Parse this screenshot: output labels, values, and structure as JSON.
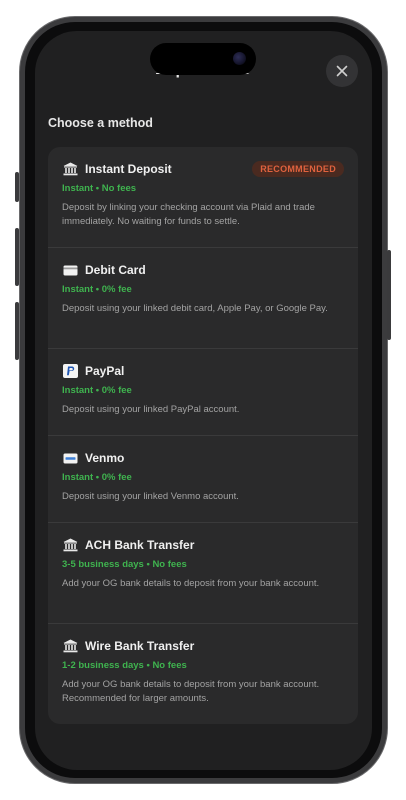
{
  "sheet": {
    "title": "Deposit USD",
    "section_label": "Choose a method",
    "close_glyph": "✕"
  },
  "methods": [
    {
      "icon": "bank-icon",
      "name": "Instant Deposit",
      "badge": "RECOMMENDED",
      "meta": "Instant • No fees",
      "description": "Deposit by linking your checking account via Plaid and trade immediately. No waiting for funds to settle."
    },
    {
      "icon": "credit-card-icon",
      "name": "Debit Card",
      "meta": "Instant • 0% fee",
      "description": "Deposit using your linked debit card, Apple Pay, or Google Pay."
    },
    {
      "icon": "paypal-icon",
      "name": "PayPal",
      "meta": "Instant • 0% fee",
      "description": "Deposit using your linked PayPal account."
    },
    {
      "icon": "venmo-icon",
      "name": "Venmo",
      "meta": "Instant • 0% fee",
      "description": "Deposit using your linked Venmo account."
    },
    {
      "icon": "bank-icon",
      "name": "ACH Bank Transfer",
      "meta": "3-5 business days • No fees",
      "description": "Add your OG bank details to deposit from your bank account."
    },
    {
      "icon": "bank-icon",
      "name": "Wire Bank Transfer",
      "meta": "1-2 business days • No fees",
      "description": "Add your OG bank details to deposit from your bank account. Recommended for larger amounts."
    }
  ],
  "colors": {
    "accent_green": "#3fb34f",
    "badge_text": "#e0623e",
    "badge_bg": "#4a2a20",
    "sheet_bg": "#202021",
    "card_bg": "#2a2a2b"
  }
}
